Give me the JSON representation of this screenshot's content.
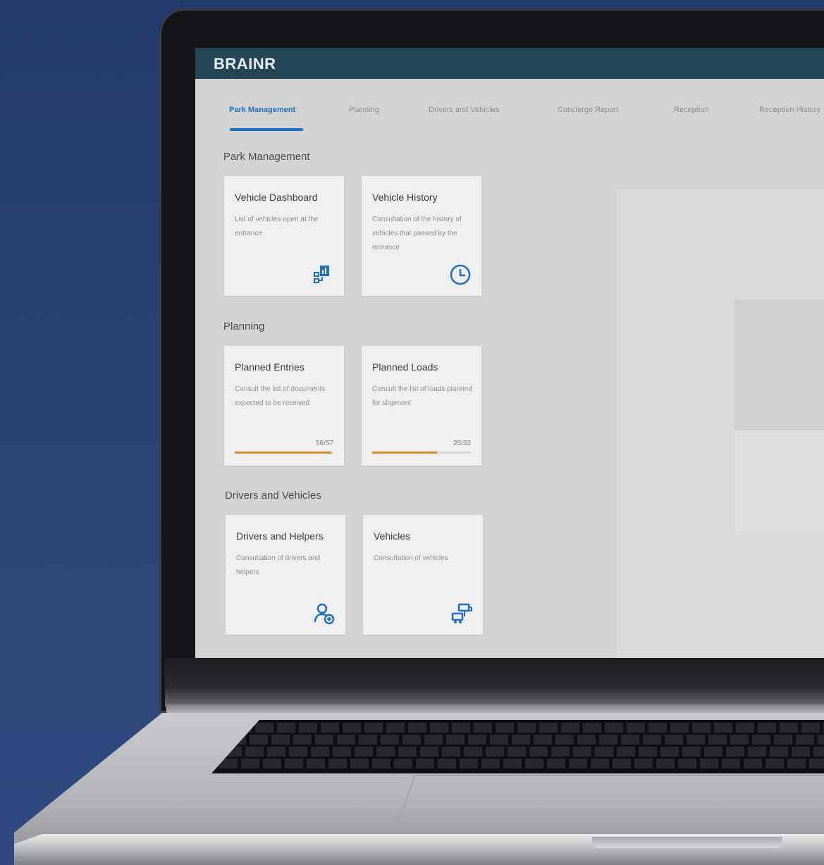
{
  "app": {
    "brand": "BRAINR"
  },
  "tabs": [
    {
      "label": "Park Management",
      "active": true
    },
    {
      "label": "Planning"
    },
    {
      "label": "Drivers and Vehicles"
    },
    {
      "label": "Concierge Report"
    },
    {
      "label": "Reception"
    },
    {
      "label": "Reception History"
    }
  ],
  "sections": {
    "park": {
      "title": "Park Management",
      "cards": [
        {
          "title": "Vehicle Dashboard",
          "desc": "List of vehicles open at the entrance",
          "icon": "dashboard-icon"
        },
        {
          "title": "Vehicle History",
          "desc": "Consultation of the history of vehicles that passed by the entrance",
          "icon": "clock-icon"
        }
      ]
    },
    "planning": {
      "title": "Planning",
      "cards": [
        {
          "title": "Planned Entries",
          "desc": "Consult the list of documents expected to be received",
          "count": "56/57",
          "progress": 0.98
        },
        {
          "title": "Planned Loads",
          "desc": "Consult the list of loads planned for shipment",
          "count": "25/33",
          "progress": 0.66
        }
      ]
    },
    "drivers": {
      "title": "Drivers and Vehicles",
      "cards": [
        {
          "title": "Drivers and Helpers",
          "desc": "Consultation of drivers and helpers",
          "icon": "user-add-icon"
        },
        {
          "title": "Vehicles",
          "desc": "Consultation of vehicles",
          "icon": "truck-icon"
        }
      ]
    }
  },
  "colors": {
    "header": "#234656",
    "accent": "#1f6fc4",
    "progress": "#e08a2e",
    "background": "#223a6e"
  }
}
